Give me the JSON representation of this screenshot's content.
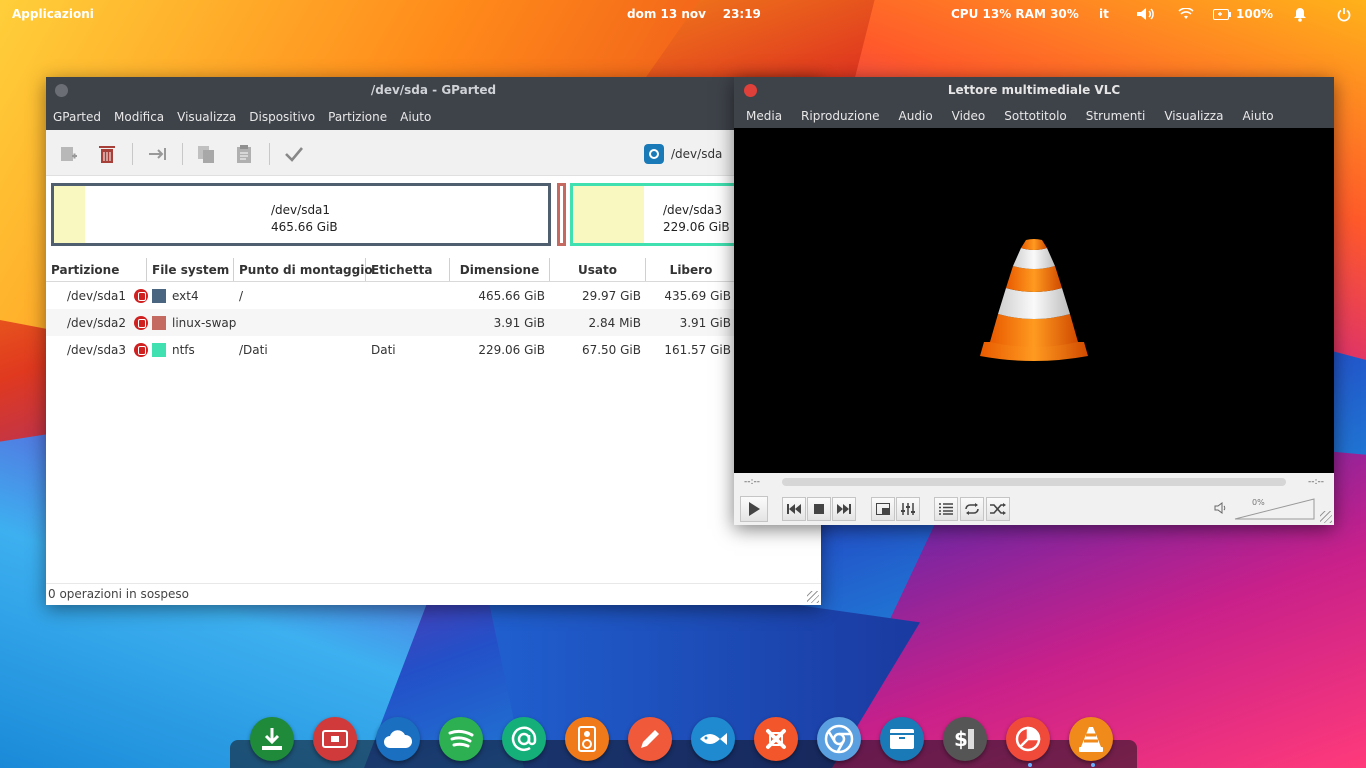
{
  "colors": {
    "gparted_titlebar": "#3e4249",
    "ext4": "#4a6580",
    "linux_swap": "#c46a60",
    "ntfs": "#40e0b0",
    "vlc_close": "#e0403a"
  },
  "topbar": {
    "apps_label": "Applicazioni",
    "datetime": "dom 13 nov    23:19",
    "sysmon": "CPU 13% RAM 30%",
    "keyboard_layout": "it",
    "battery": "100%",
    "icons": [
      "volume-icon",
      "wifi-icon",
      "battery-icon",
      "bell-icon",
      "power-icon"
    ]
  },
  "gparted": {
    "title": "/dev/sda - GParted",
    "menu": [
      "GParted",
      "Modifica",
      "Visualizza",
      "Dispositivo",
      "Partizione",
      "Aiuto"
    ],
    "toolbar_icons": [
      "new-partition-icon",
      "delete-icon",
      "resize-move-icon",
      "copy-icon",
      "paste-icon",
      "apply-icon"
    ],
    "device": "/dev/sda",
    "device_suffix": "(",
    "map": {
      "sda1": {
        "name": "/dev/sda1",
        "size": "465.66 GiB"
      },
      "sda3": {
        "name": "/dev/sda3",
        "size": "229.06 GiB"
      }
    },
    "columns": [
      "Partizione",
      "File system",
      "Punto di montaggio",
      "Etichetta",
      "Dimensione",
      "Usato",
      "Libero"
    ],
    "rows": [
      {
        "partition": "/dev/sda1",
        "fs": "ext4",
        "mount": "/",
        "label": "",
        "size": "465.66 GiB",
        "used": "29.97 GiB",
        "free": "435.69 GiB"
      },
      {
        "partition": "/dev/sda2",
        "fs": "linux-swap",
        "mount": "",
        "label": "",
        "size": "3.91 GiB",
        "used": "2.84 MiB",
        "free": "3.91 GiB"
      },
      {
        "partition": "/dev/sda3",
        "fs": "ntfs",
        "mount": "/Dati",
        "label": "Dati",
        "size": "229.06 GiB",
        "used": "67.50 GiB",
        "free": "161.57 GiB"
      }
    ],
    "status": "0 operazioni in sospeso"
  },
  "vlc": {
    "title": "Lettore multimediale VLC",
    "menu": [
      "Media",
      "Riproduzione",
      "Audio",
      "Video",
      "Sottotitolo",
      "Strumenti",
      "Visualizza",
      "Aiuto"
    ],
    "time_elapsed": "--:--",
    "time_total": "--:--",
    "volume": "0%",
    "control_icons": [
      "play-icon",
      "prev-icon",
      "stop-icon",
      "next-icon",
      "fullscreen-icon",
      "equalizer-icon",
      "playlist-icon",
      "loop-icon",
      "shuffle-icon",
      "speaker-icon"
    ]
  },
  "dock": {
    "apps": [
      {
        "name": "downloader",
        "color": "#1e8a3a"
      },
      {
        "name": "disk-app",
        "color": "#d03a3a"
      },
      {
        "name": "cloud",
        "color": "#1b6fc0"
      },
      {
        "name": "spotify",
        "color": "#2cb052"
      },
      {
        "name": "mail",
        "color": "#15b07a"
      },
      {
        "name": "speaker",
        "color": "#f07a1a"
      },
      {
        "name": "editor",
        "color": "#f05a3a"
      },
      {
        "name": "fish",
        "color": "#1f8ad0"
      },
      {
        "name": "xampp",
        "color": "#f2562a"
      },
      {
        "name": "chrome",
        "color": "#5aa0e0"
      },
      {
        "name": "archive",
        "color": "#1a7ab8"
      },
      {
        "name": "terminal",
        "color": "#555555"
      },
      {
        "name": "chart",
        "color": "#f04a3a"
      },
      {
        "name": "vlc",
        "color": "#f08a1a"
      }
    ]
  }
}
